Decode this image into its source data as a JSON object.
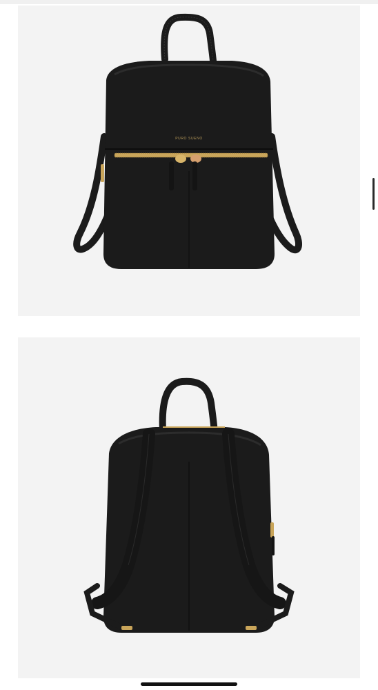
{
  "gallery": {
    "images": [
      {
        "view": "front",
        "brand_mark": "PURO SUENO"
      },
      {
        "view": "back"
      }
    ]
  },
  "colors": {
    "page_background": "#ffffff",
    "card_background": "#f3f3f3",
    "leather": "#1b1b1b",
    "hardware_gold": "#c9a55a"
  }
}
